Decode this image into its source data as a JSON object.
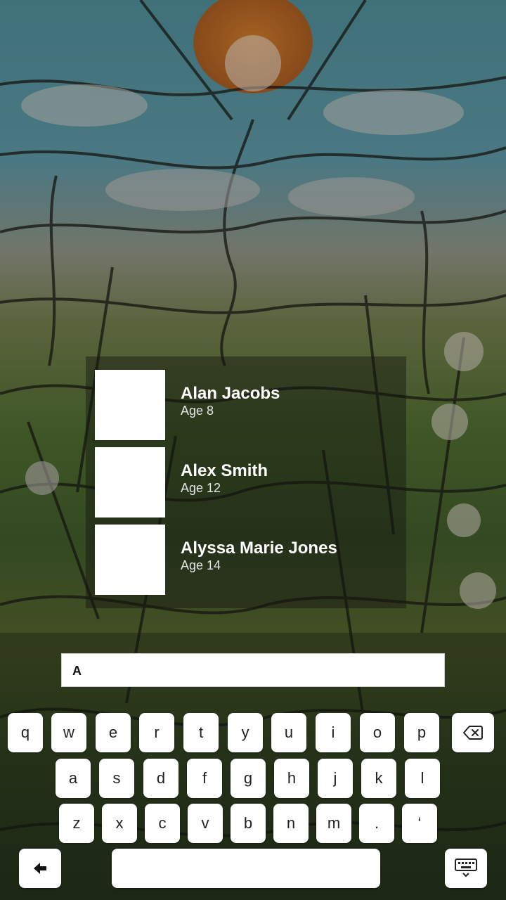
{
  "results": [
    {
      "name": "Alan Jacobs",
      "age": "Age 8"
    },
    {
      "name": "Alex Smith",
      "age": "Age 12"
    },
    {
      "name": "Alyssa Marie Jones",
      "age": "Age 14"
    }
  ],
  "search": {
    "value": "A"
  },
  "keyboard": {
    "row1": [
      "q",
      "w",
      "e",
      "r",
      "t",
      "y",
      "u",
      "i",
      "o",
      "p"
    ],
    "row2": [
      "a",
      "s",
      "d",
      "f",
      "g",
      "h",
      "j",
      "k",
      "l"
    ],
    "row3": [
      "z",
      "x",
      "c",
      "v",
      "b",
      "n",
      "m",
      ".",
      "‘"
    ]
  },
  "icons": {
    "backspace": "backspace-icon",
    "back": "back-arrow-icon",
    "keyboard": "keyboard-hide-icon"
  }
}
